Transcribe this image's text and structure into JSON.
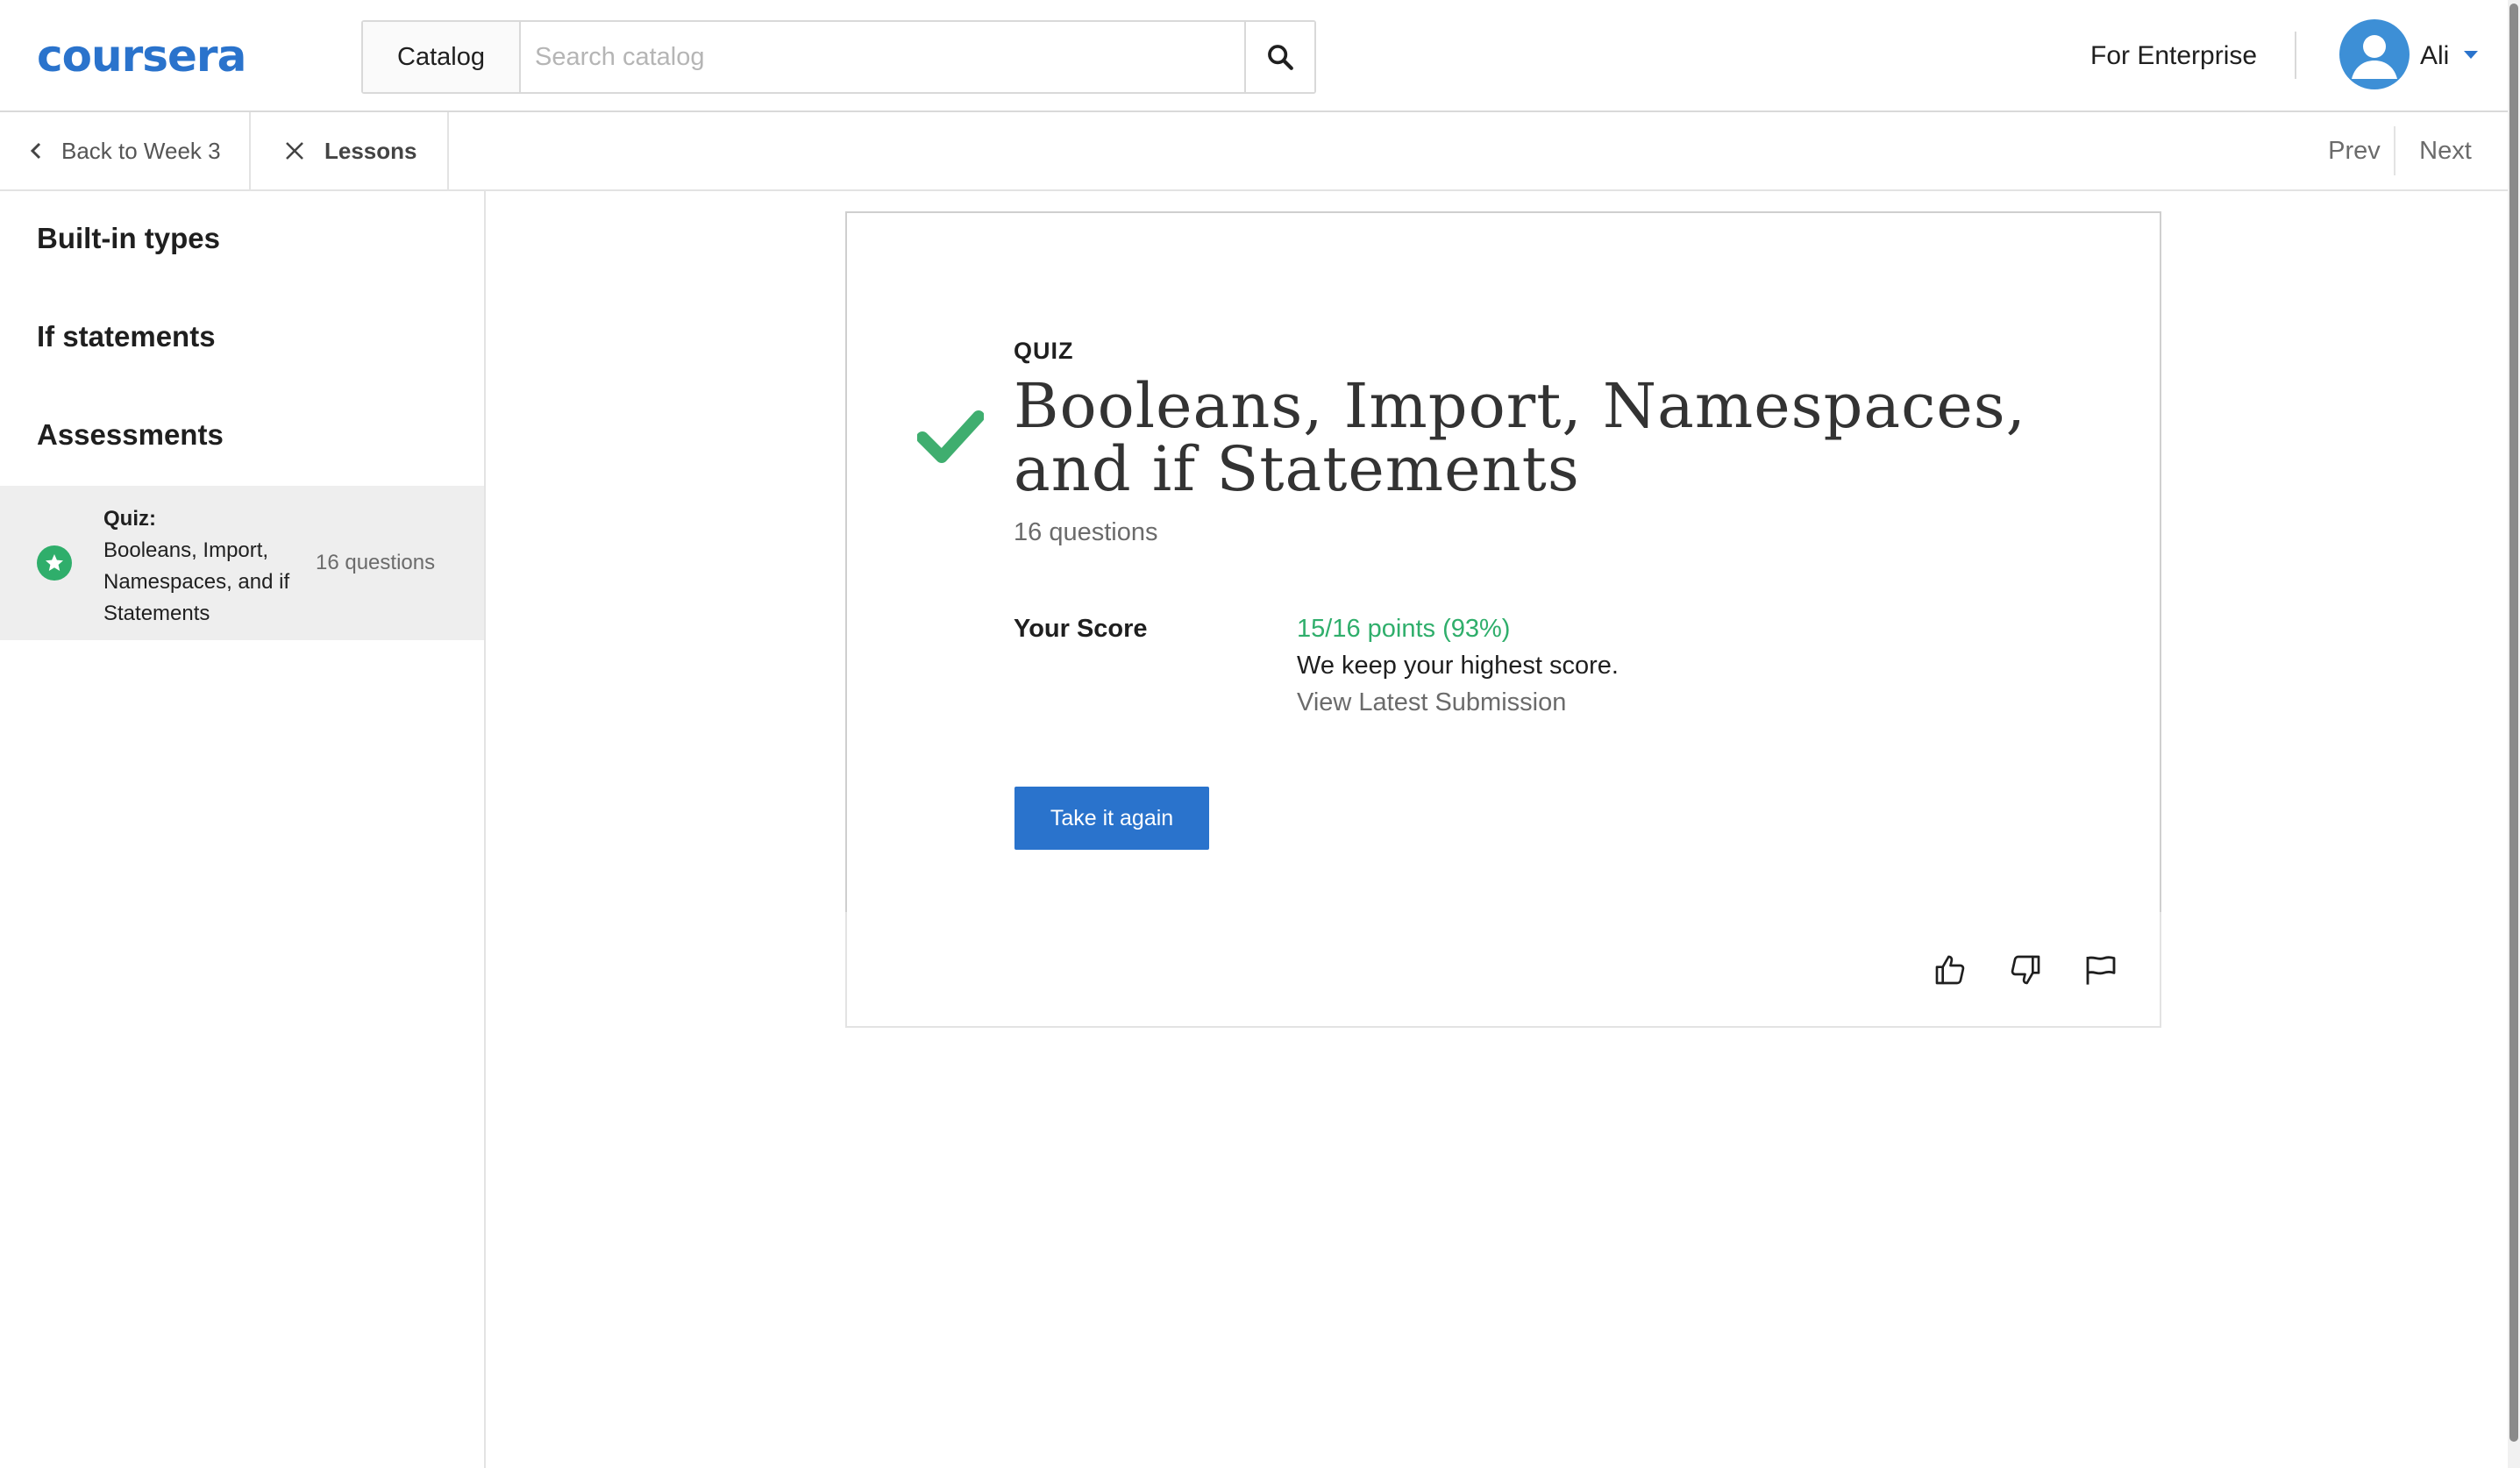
{
  "header": {
    "logo_text": "coursera",
    "catalog_label": "Catalog",
    "search_placeholder": "Search catalog",
    "enterprise_label": "For Enterprise",
    "user_name": "Ali"
  },
  "subnav": {
    "back_label": "Back to Week 3",
    "lessons_label": "Lessons",
    "prev_label": "Prev",
    "next_label": "Next"
  },
  "sidebar": {
    "sections": [
      "Built-in types",
      "If statements",
      "Assessments"
    ],
    "active_item": {
      "type_label": "Quiz:",
      "title": "Booleans, Import, Namespaces, and if Statements",
      "count": "16 questions",
      "status": "completed"
    }
  },
  "quiz": {
    "label": "QUIZ",
    "title": "Booleans, Import, Namespaces, and if Statements",
    "questions": "16 questions",
    "score_label": "Your Score",
    "score_value": "15/16 points (93%)",
    "score_note": "We keep your highest score.",
    "latest_link": "View Latest Submission",
    "retake_label": "Take it again",
    "passed": true
  },
  "feedback": {
    "icons": [
      "thumbs-up-icon",
      "thumbs-down-icon",
      "flag-icon"
    ]
  },
  "colors": {
    "brand": "#2a73cc",
    "success": "#2fae6b",
    "muted": "#6b6b6b",
    "border": "#d9d9d9"
  }
}
